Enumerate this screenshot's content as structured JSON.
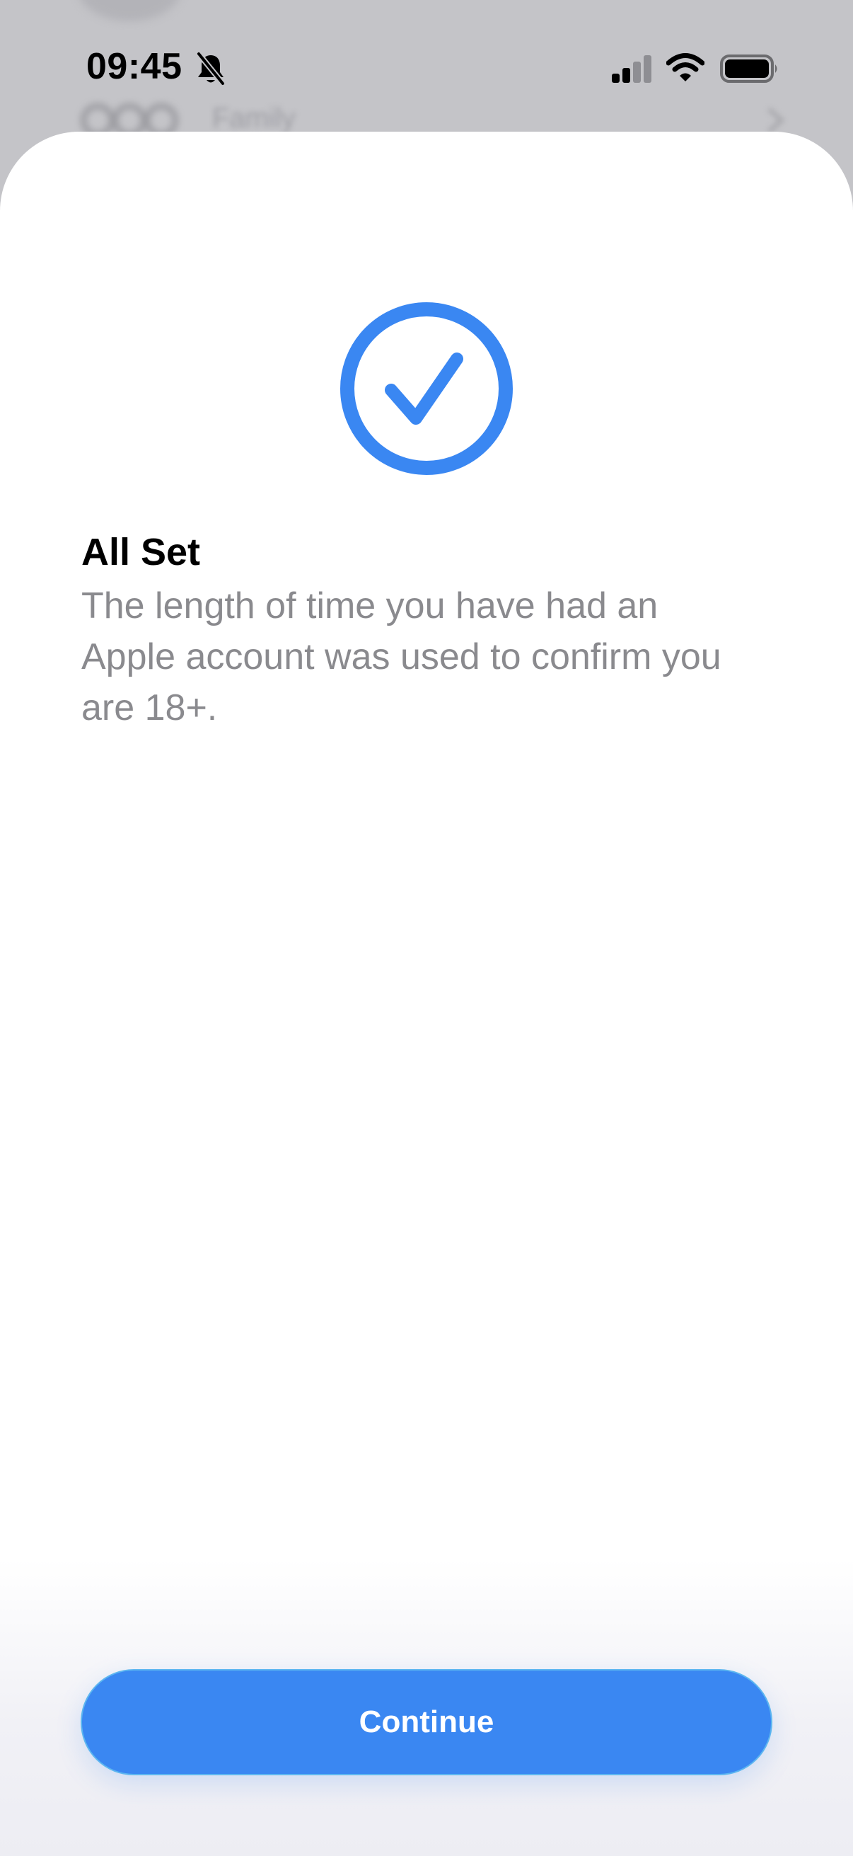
{
  "status_bar": {
    "time": "09:45"
  },
  "background": {
    "row_label": "Family"
  },
  "sheet": {
    "title": "All Set",
    "body": "The length of time you have had an Apple account was used to confirm you are 18+.",
    "continue_label": "Continue"
  },
  "icons": {
    "status": [
      "bell-slash-icon",
      "cellular-signal-icon",
      "wifi-icon",
      "battery-icon"
    ],
    "main": "checkmark-circle-icon"
  },
  "colors": {
    "accent": "#3a87f2",
    "check": "#3a87f2",
    "body_text": "#8a8a8e",
    "backdrop": "#c4c4c8",
    "button_border": "#5cb6f0"
  }
}
